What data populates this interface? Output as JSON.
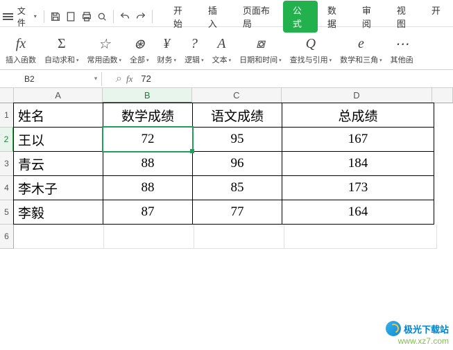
{
  "menu": {
    "file": "文件"
  },
  "tabs": [
    "开始",
    "插入",
    "页面布局",
    "公式",
    "数据",
    "审阅",
    "视图",
    "开"
  ],
  "active_tab_index": 3,
  "ribbon": [
    {
      "icon": "fx",
      "label": "插入函数",
      "dd": false
    },
    {
      "icon": "Σ",
      "label": "自动求和",
      "dd": true
    },
    {
      "icon": "☆",
      "label": "常用函数",
      "dd": true
    },
    {
      "icon": "⊛",
      "label": "全部",
      "dd": true
    },
    {
      "icon": "¥",
      "label": "财务",
      "dd": true
    },
    {
      "icon": "?",
      "label": "逻辑",
      "dd": true
    },
    {
      "icon": "A",
      "label": "文本",
      "dd": true
    },
    {
      "icon": "⧇",
      "label": "日期和时间",
      "dd": true
    },
    {
      "icon": "Q",
      "label": "查找与引用",
      "dd": true
    },
    {
      "icon": "e",
      "label": "数学和三角",
      "dd": true
    },
    {
      "icon": "⋯",
      "label": "其他函",
      "dd": false
    }
  ],
  "namebox": "B2",
  "formula": "72",
  "columns": [
    "A",
    "B",
    "C",
    "D"
  ],
  "active_col_index": 1,
  "active_row_index": 1,
  "headers": [
    "姓名",
    "数学成绩",
    "语文成绩",
    "总成绩"
  ],
  "rows": [
    {
      "name": "王以",
      "math": "72",
      "chinese": "95",
      "total": "167"
    },
    {
      "name": "青云",
      "math": "88",
      "chinese": "96",
      "total": "184"
    },
    {
      "name": "李木子",
      "math": "88",
      "chinese": "85",
      "total": "173"
    },
    {
      "name": "李毅",
      "math": "87",
      "chinese": "77",
      "total": "164"
    }
  ],
  "watermark": {
    "name": "极光下载站",
    "url": "www.xz7.com"
  }
}
